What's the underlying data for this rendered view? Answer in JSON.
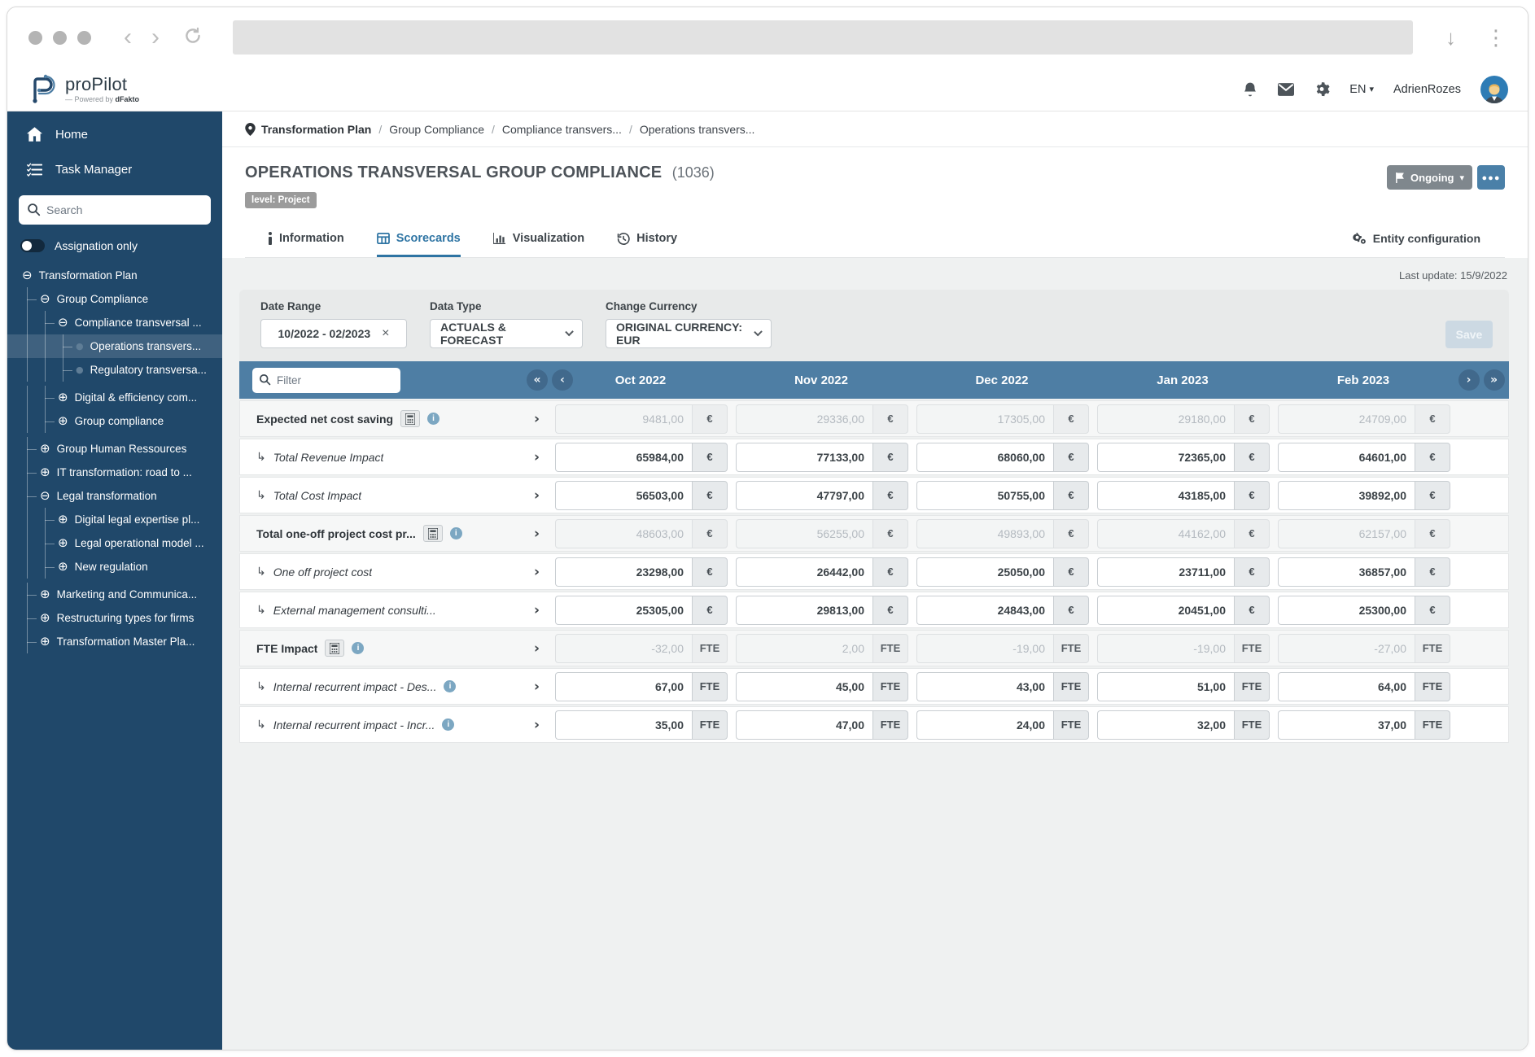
{
  "colors": {
    "sidebar": "#20486a",
    "table_header": "#4e7ea4",
    "accent": "#2e74a3",
    "status_gray": "#7f878d",
    "more_blue": "#4a80a8"
  },
  "icons": {
    "expanded": "⊖",
    "collapsed": "⊕",
    "leaf": "●",
    "child_arrow": "↳",
    "row_chevron": "›",
    "pager_first": "«",
    "pager_prev": "‹",
    "pager_next": "›",
    "pager_last": "»",
    "download": "↓",
    "kebab": "⋮",
    "back": "‹",
    "forward": "›",
    "close": "×",
    "caret_down": "▾",
    "ellipsis": "•••"
  },
  "header": {
    "logo_name": "proPilot",
    "logo_sub_prefix": "— Powered by ",
    "logo_sub_brand": "dFakto",
    "lang": "EN",
    "username": "AdrienRozes"
  },
  "sidebar": {
    "home": "Home",
    "task_manager": "Task Manager",
    "search_placeholder": "Search",
    "toggle_label": "Assignation only",
    "tree": [
      {
        "label": "Transformation Plan",
        "depth": 0,
        "state": "expanded"
      },
      {
        "label": "Group Compliance",
        "depth": 1,
        "state": "expanded"
      },
      {
        "label": "Compliance transversal ...",
        "depth": 2,
        "state": "expanded"
      },
      {
        "label": "Operations transvers...",
        "depth": 3,
        "state": "leaf",
        "selected": true
      },
      {
        "label": "Regulatory transversa...",
        "depth": 3,
        "state": "leaf"
      },
      {
        "label": "Digital & efficiency com...",
        "depth": 2,
        "state": "collapsed"
      },
      {
        "label": "Group compliance",
        "depth": 2,
        "state": "collapsed"
      },
      {
        "label": "Group Human Ressources",
        "depth": 1,
        "state": "collapsed"
      },
      {
        "label": "IT transformation: road to ...",
        "depth": 1,
        "state": "collapsed"
      },
      {
        "label": "Legal transformation",
        "depth": 1,
        "state": "expanded"
      },
      {
        "label": "Digital legal expertise pl...",
        "depth": 2,
        "state": "collapsed"
      },
      {
        "label": "Legal operational model ...",
        "depth": 2,
        "state": "collapsed"
      },
      {
        "label": "New regulation",
        "depth": 2,
        "state": "collapsed"
      },
      {
        "label": "Marketing and Communica...",
        "depth": 1,
        "state": "collapsed"
      },
      {
        "label": "Restructuring types for firms",
        "depth": 1,
        "state": "collapsed"
      },
      {
        "label": "Transformation Master Pla...",
        "depth": 1,
        "state": "collapsed"
      }
    ]
  },
  "breadcrumb": {
    "items": [
      "Transformation Plan",
      "Group Compliance",
      "Compliance transvers...",
      "Operations transvers..."
    ]
  },
  "page": {
    "title": "OPERATIONS TRANSVERSAL GROUP COMPLIANCE",
    "id": "(1036)",
    "level_badge": "level: Project",
    "status": "Ongoing",
    "tabs": [
      {
        "label": "Information",
        "icon": "info-icon",
        "active": false
      },
      {
        "label": "Scorecards",
        "icon": "table-icon",
        "active": true
      },
      {
        "label": "Visualization",
        "icon": "chart-icon",
        "active": false
      },
      {
        "label": "History",
        "icon": "history-icon",
        "active": false
      }
    ],
    "entity_config": "Entity configuration",
    "last_update": "Last update: 15/9/2022"
  },
  "filters": {
    "date_range_label": "Date Range",
    "date_range_value": "10/2022 - 02/2023",
    "data_type_label": "Data Type",
    "data_type_value": "ACTUALS & FORECAST",
    "currency_label": "Change Currency",
    "currency_value": "ORIGINAL CURRENCY: EUR",
    "save_label": "Save"
  },
  "table": {
    "filter_placeholder": "Filter",
    "columns": [
      "Oct 2022",
      "Nov 2022",
      "Dec 2022",
      "Jan 2023",
      "Feb 2023"
    ],
    "rows": [
      {
        "label": "Expected net cost saving",
        "kind": "parent",
        "calc": true,
        "info": true,
        "readonly": true,
        "unit": "€",
        "values": [
          "9481,00",
          "29336,00",
          "17305,00",
          "29180,00",
          "24709,00"
        ]
      },
      {
        "label": "Total Revenue Impact",
        "kind": "child",
        "calc": false,
        "info": false,
        "readonly": false,
        "unit": "€",
        "values": [
          "65984,00",
          "77133,00",
          "68060,00",
          "72365,00",
          "64601,00"
        ]
      },
      {
        "label": "Total Cost Impact",
        "kind": "child",
        "calc": false,
        "info": false,
        "readonly": false,
        "unit": "€",
        "values": [
          "56503,00",
          "47797,00",
          "50755,00",
          "43185,00",
          "39892,00"
        ]
      },
      {
        "label": "Total one-off project cost pr...",
        "kind": "parent",
        "calc": true,
        "info": true,
        "readonly": true,
        "unit": "€",
        "values": [
          "48603,00",
          "56255,00",
          "49893,00",
          "44162,00",
          "62157,00"
        ]
      },
      {
        "label": "One off project cost",
        "kind": "child",
        "calc": false,
        "info": false,
        "readonly": false,
        "unit": "€",
        "values": [
          "23298,00",
          "26442,00",
          "25050,00",
          "23711,00",
          "36857,00"
        ]
      },
      {
        "label": "External management consulti...",
        "kind": "child",
        "calc": false,
        "info": false,
        "readonly": false,
        "unit": "€",
        "values": [
          "25305,00",
          "29813,00",
          "24843,00",
          "20451,00",
          "25300,00"
        ]
      },
      {
        "label": "FTE Impact",
        "kind": "parent",
        "calc": true,
        "info": true,
        "readonly": true,
        "unit": "FTE",
        "values": [
          "-32,00",
          "2,00",
          "-19,00",
          "-19,00",
          "-27,00"
        ]
      },
      {
        "label": "Internal recurrent impact - Des...",
        "kind": "child",
        "calc": false,
        "info": true,
        "readonly": false,
        "unit": "FTE",
        "values": [
          "67,00",
          "45,00",
          "43,00",
          "51,00",
          "64,00"
        ]
      },
      {
        "label": "Internal recurrent impact - Incr...",
        "kind": "child",
        "calc": false,
        "info": true,
        "readonly": false,
        "unit": "FTE",
        "values": [
          "35,00",
          "47,00",
          "24,00",
          "32,00",
          "37,00"
        ]
      }
    ]
  }
}
